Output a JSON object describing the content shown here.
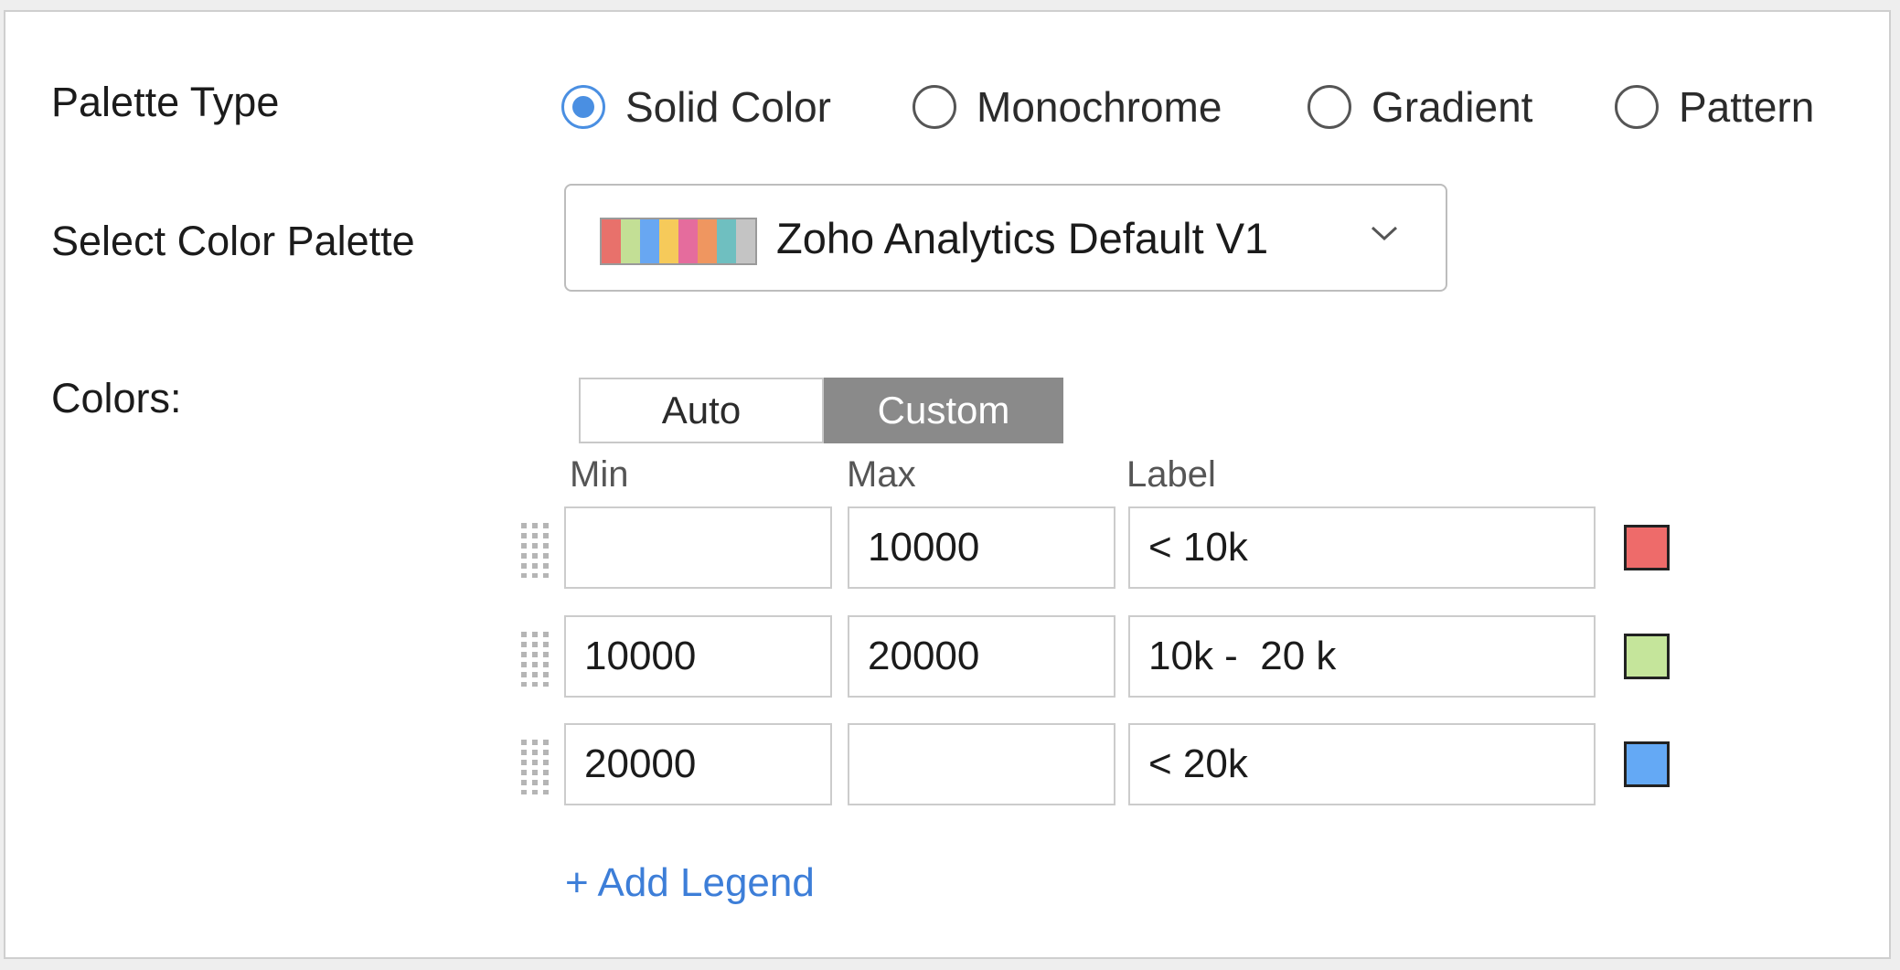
{
  "palette_type": {
    "label": "Palette Type",
    "options": [
      {
        "label": "Solid Color",
        "selected": true
      },
      {
        "label": "Monochrome",
        "selected": false
      },
      {
        "label": "Gradient",
        "selected": false
      },
      {
        "label": "Pattern",
        "selected": false
      }
    ]
  },
  "color_palette": {
    "label": "Select Color Palette",
    "selected": "Zoho Analytics Default V1",
    "swatch_colors": [
      "#e8716b",
      "#c3df95",
      "#68a7f2",
      "#f6ca5a",
      "#e56c9d",
      "#ef9660",
      "#6fbfc0",
      "#c4c4c4"
    ],
    "dropdown_icon": "chevron-down-icon"
  },
  "colors": {
    "label": "Colors:",
    "mode_options": [
      {
        "label": "Auto",
        "active": false
      },
      {
        "label": "Custom",
        "active": true
      }
    ],
    "columns": {
      "min": "Min",
      "max": "Max",
      "label": "Label"
    },
    "rows": [
      {
        "min": "",
        "max": "10000",
        "label": "< 10k",
        "color": "#ee6b6a"
      },
      {
        "min": "10000",
        "max": "20000",
        "label": "10k -  20 k",
        "color": "#c5e59b"
      },
      {
        "min": "20000",
        "max": "",
        "label": "< 20k",
        "color": "#64a9f5"
      }
    ],
    "add_legend_label": "+ Add Legend"
  },
  "theme": {
    "accent": "#4a8fe2",
    "link": "#3d7ed8",
    "toggle_active_bg": "#8a8a8a"
  }
}
